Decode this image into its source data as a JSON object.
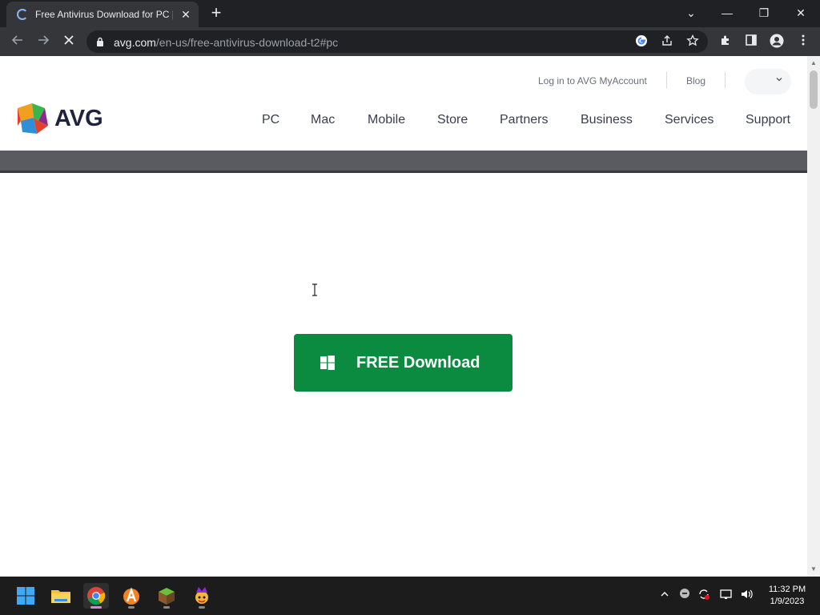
{
  "browser": {
    "tab_title": "Free Antivirus Download for PC |",
    "tab_close": "✕",
    "new_tab": "+",
    "url_host": "avg.com",
    "url_path": "/en-us/free-antivirus-download-t2#pc",
    "window_controls": {
      "list": "⌄",
      "minimize": "—",
      "restore": "❐",
      "close": "✕"
    }
  },
  "site": {
    "utility_links": {
      "login": "Log in to AVG MyAccount",
      "blog": "Blog"
    },
    "logo_text": "AVG",
    "nav": [
      "PC",
      "Mac",
      "Mobile",
      "Store",
      "Partners",
      "Business",
      "Services",
      "Support"
    ],
    "cta_label": "FREE Download"
  },
  "taskbar": {
    "apps": [
      "start-icon",
      "file-explorer-icon",
      "chrome-icon",
      "avast-icon",
      "minecraft-icon",
      "game-icon"
    ],
    "time": "11:32 PM",
    "date": "1/9/2023"
  },
  "colors": {
    "cta_green": "#0b8b3f",
    "chrome_dark": "#202124",
    "toolbar": "#35363a",
    "taskbar": "#1c1c1c"
  }
}
